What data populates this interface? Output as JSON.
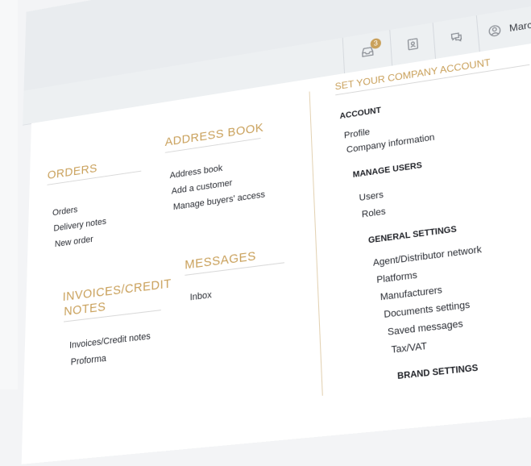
{
  "header": {
    "notifications_count": "3",
    "user_name": "Marcus Howard"
  },
  "orders": {
    "title": "ORDERS",
    "items": [
      "Orders",
      "Delivery notes",
      "New order"
    ]
  },
  "address_book": {
    "title": "ADDRESS BOOK",
    "items": [
      "Address book",
      "Add a customer",
      "Manage buyers' access"
    ]
  },
  "invoices": {
    "title_line1": "INVOICES/CREDIT",
    "title_line2": "NOTES",
    "items": [
      "Invoices/Credit notes",
      "Proforma"
    ]
  },
  "messages": {
    "title": "MESSAGES",
    "items": [
      "Inbox"
    ]
  },
  "company": {
    "title": "SET YOUR COMPANY ACCOUNT",
    "account": {
      "heading": "ACCOUNT",
      "items": [
        "Profile",
        "Company information"
      ]
    },
    "manage_users": {
      "heading": "MANAGE USERS",
      "items": [
        "Users",
        "Roles"
      ]
    },
    "general_settings": {
      "heading": "GENERAL SETTINGS",
      "items": [
        "Agent/Distributor network",
        "Platforms",
        "Manufacturers",
        "Documents settings",
        "Saved messages",
        "Tax/VAT"
      ]
    },
    "brand_settings": {
      "heading": "BRAND SETTINGS"
    }
  }
}
